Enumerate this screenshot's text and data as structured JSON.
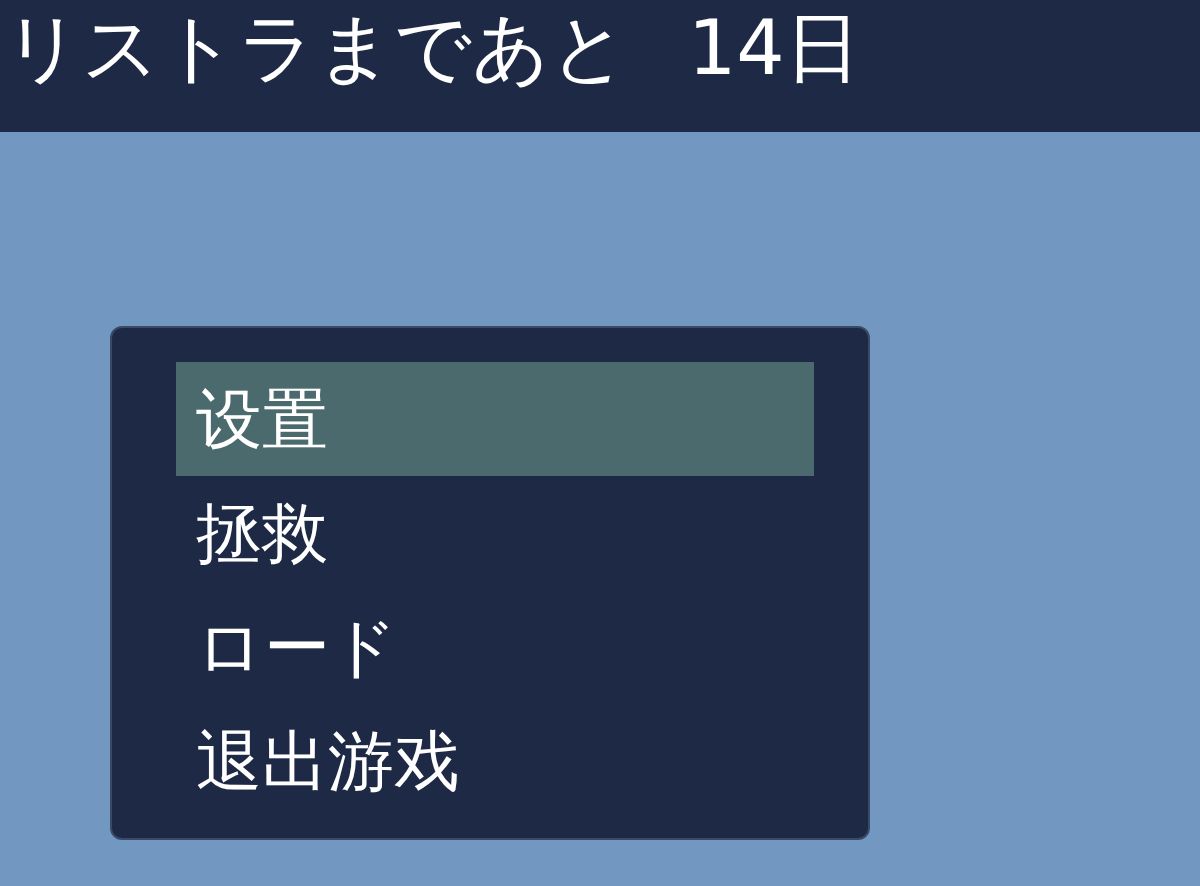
{
  "status_bar": {
    "label": "リストラまであと",
    "days": "14日"
  },
  "menu": {
    "items": [
      {
        "label": "设置",
        "selected": true
      },
      {
        "label": "拯救",
        "selected": false
      },
      {
        "label": "ロード",
        "selected": false
      },
      {
        "label": "退出游戏",
        "selected": false
      }
    ]
  }
}
